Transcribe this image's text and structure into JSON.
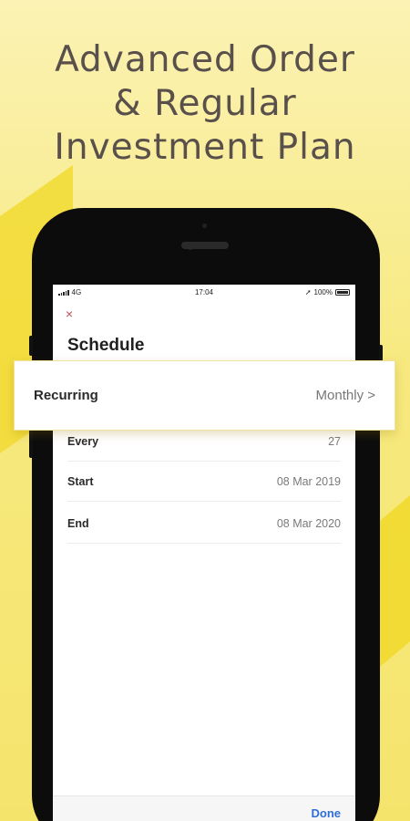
{
  "headline": {
    "line1": "Advanced Order",
    "line2": "& Regular",
    "line3": "Investment Plan"
  },
  "status_bar": {
    "network": "4G",
    "time": "17:04",
    "battery": "100%"
  },
  "screen": {
    "title": "Schedule",
    "close_icon": "×",
    "rows": [
      {
        "label": "Every",
        "value": "27"
      },
      {
        "label": "Start",
        "value": "08 Mar 2019"
      },
      {
        "label": "End",
        "value": "08 Mar 2020"
      }
    ],
    "done_label": "Done"
  },
  "popout": {
    "label": "Recurring",
    "value": "Monthly >"
  },
  "colors": {
    "background": "#f7e97f",
    "accent_yellow": "#f2dc37",
    "headline_text": "#59504c",
    "done_blue": "#2f6fd6",
    "close_red": "#c44d4d"
  }
}
